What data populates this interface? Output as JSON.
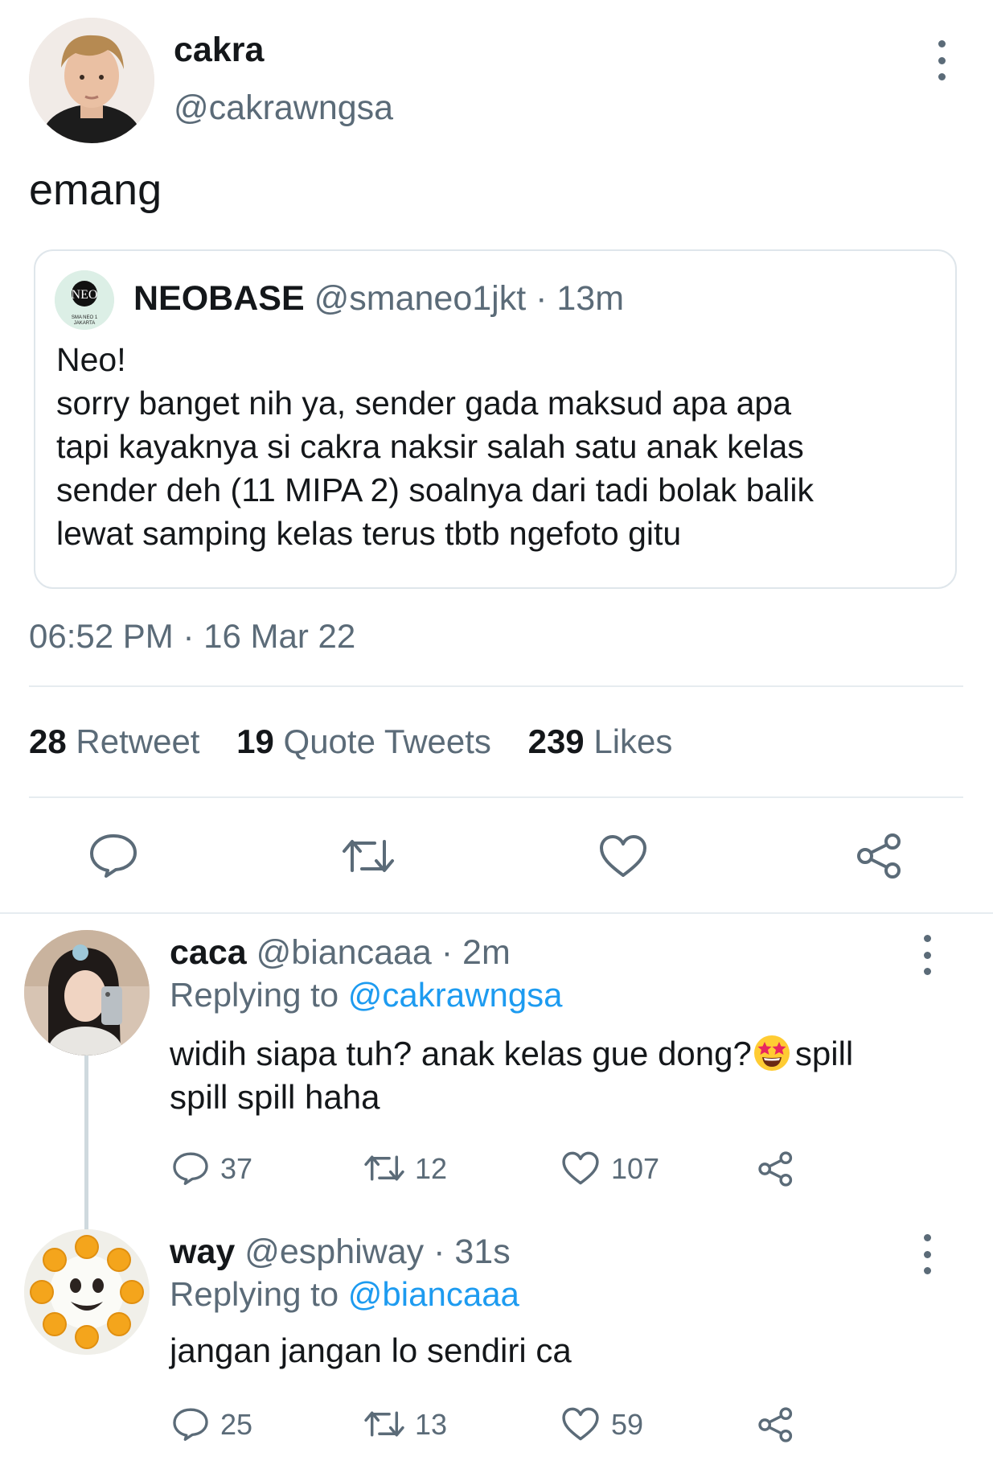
{
  "main_tweet": {
    "name": "cakra",
    "handle": "@cakrawngsa",
    "text": "emang",
    "quoted": {
      "name": "NEOBASE",
      "handle": "@smaneo1jkt",
      "time": "· 13m",
      "logo_text_top": "NEO",
      "logo_text_bottom": "SMA NEO 1 JAKARTA",
      "lines": [
        "Neo!",
        "sorry banget nih ya, sender gada maksud apa apa",
        "tapi kayaknya si cakra naksir salah satu anak kelas",
        "sender deh (11 MIPA 2) soalnya dari tadi bolak balik",
        "lewat samping kelas terus tbtb ngefoto gitu"
      ]
    },
    "timestamp": "06:52 PM · 16 Mar 22",
    "stats": {
      "retweets": "28",
      "retweets_label": "Retweet",
      "quotes": "19",
      "quotes_label": "Quote Tweets",
      "likes": "239",
      "likes_label": "Likes"
    },
    "icons": [
      "reply-icon",
      "retweet-icon",
      "like-icon",
      "share-icon"
    ]
  },
  "replies": [
    {
      "name": "caca",
      "handle": "@biancaaa",
      "time": "· 2m",
      "replying_prefix": "Replying to",
      "replying_to": "@cakrawngsa",
      "line1": "widih siapa tuh? anak kelas gue dong?",
      "emoji": "star-struck-emoji",
      "line1_end": "spill",
      "line2": "spill spill haha",
      "reply_count": "37",
      "retweet_count": "12",
      "like_count": "107"
    },
    {
      "name": "way",
      "handle": "@esphiway",
      "time": "· 31s",
      "replying_prefix": "Replying to",
      "replying_to": "@biancaaa",
      "line1": "jangan jangan lo sendiri ca",
      "reply_count": "25",
      "retweet_count": "13",
      "like_count": "59"
    }
  ],
  "colors": {
    "accent": "#1d9bf0",
    "muted": "#5b6b78",
    "divider": "#e6ecf0",
    "text": "#14171a"
  }
}
